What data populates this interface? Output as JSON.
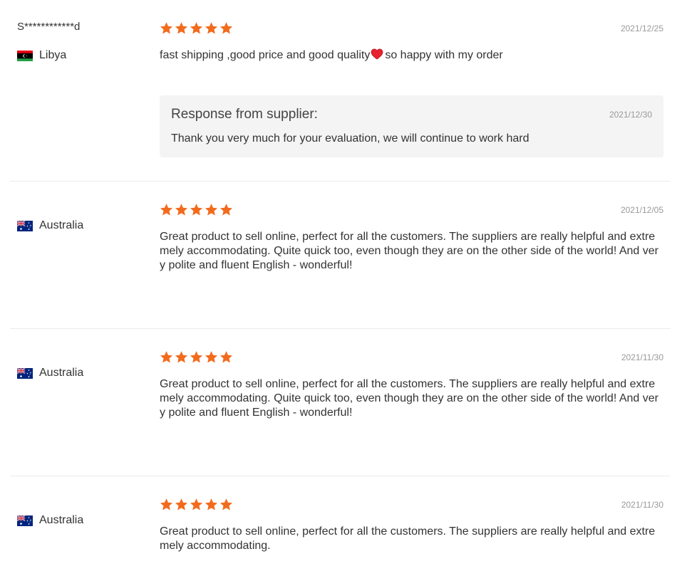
{
  "colors": {
    "star": "#f26b1d",
    "heart": "#e8212e",
    "divider": "#ebebeb",
    "response_bg": "#f4f4f4",
    "date_text": "#999999"
  },
  "reviews": [
    {
      "buyer": "S************d",
      "country": "Libya",
      "flag_icon": "libya-flag-icon",
      "rating": 5,
      "date": "2021/12/25",
      "text_before_heart": "fast shipping ,good price and good quality",
      "heart_icon": "red-heart-icon",
      "text_after_heart": "so happy with my order",
      "response": {
        "title": "Response from supplier:",
        "date": "2021/12/30",
        "text": "Thank you very much for your evaluation, we will continue to work hard"
      }
    },
    {
      "buyer": "",
      "country": "Australia",
      "flag_icon": "australia-flag-icon",
      "rating": 5,
      "date": "2021/12/05",
      "text_lines": [
        "Great product to sell online, perfect for all the customers. The suppliers are really helpful and extre",
        "mely accommodating. Quite quick too, even though they are on the other side of the world! And ver",
        "y polite and fluent English - wonderful!"
      ]
    },
    {
      "buyer": "",
      "country": "Australia",
      "flag_icon": "australia-flag-icon",
      "rating": 5,
      "date": "2021/11/30",
      "text_lines": [
        "Great product to sell online, perfect for all the customers. The suppliers are really helpful and extre",
        "mely accommodating. Quite quick too, even though they are on the other side of the world! And ver",
        "y polite and fluent English - wonderful!"
      ]
    },
    {
      "buyer": "",
      "country": "Australia",
      "flag_icon": "australia-flag-icon",
      "rating": 5,
      "date": "2021/11/30",
      "text_lines": [
        "Great product to sell online, perfect for all the customers. The suppliers are really helpful and extre",
        "mely accommodating."
      ]
    }
  ]
}
